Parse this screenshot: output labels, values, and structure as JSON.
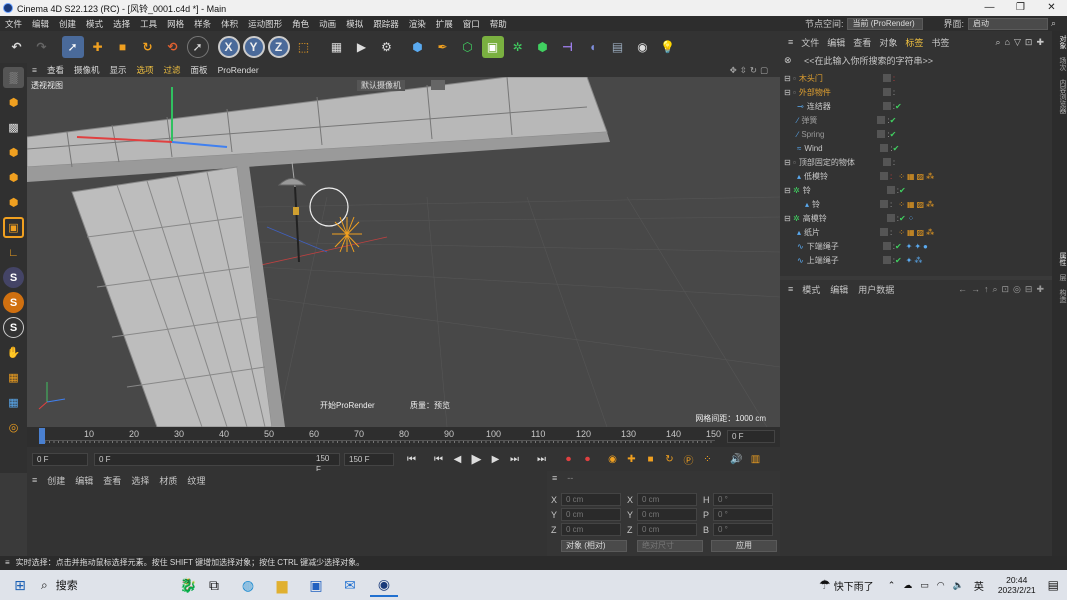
{
  "window": {
    "title": "Cinema 4D S22.123 (RC) - [风铃_0001.c4d *] - Main",
    "min": "—",
    "max": "❐",
    "close": "✕"
  },
  "menubar": {
    "items": [
      "文件",
      "编辑",
      "创建",
      "模式",
      "选择",
      "工具",
      "网格",
      "样条",
      "体积",
      "运动图形",
      "角色",
      "动画",
      "模拟",
      "跟踪器",
      "渲染",
      "扩展",
      "窗口",
      "帮助"
    ],
    "node_space_label": "节点空间:",
    "node_space_value": "当前 (ProRender)",
    "layout_label": "界面:",
    "layout_value": "启动"
  },
  "toolbar": {
    "icons": [
      "undo-icon",
      "redo-icon",
      "live-select-icon",
      "move-icon",
      "scale-icon",
      "rotate-icon",
      "recent-tools-icon",
      "select-icon",
      "x-axis-icon",
      "y-axis-icon",
      "z-axis-icon",
      "coordinate-system-icon",
      "render-view-icon",
      "render-picture-queue-icon",
      "render-settings-icon",
      "cube-icon",
      "pen-icon",
      "subdivision-icon",
      "array-icon",
      "cloner-icon",
      "voronoi-icon",
      "mograph-icon",
      "bend-icon",
      "deformer-icon",
      "floor-icon",
      "camera-icon",
      "light-icon"
    ]
  },
  "viewport": {
    "menu": [
      "查看",
      "摄像机",
      "显示",
      "选项",
      "过滤",
      "面板",
      "ProRender"
    ],
    "label": "透视视图",
    "camera": "默认摄像机",
    "prorender_start": "开始ProRender",
    "quality": "质量：预览",
    "grid_spacing": "网格间距：1000 cm"
  },
  "timeline": {
    "ticks": [
      "0",
      "10",
      "20",
      "30",
      "40",
      "50",
      "60",
      "70",
      "80",
      "90",
      "100",
      "110",
      "120",
      "130",
      "140",
      "150"
    ],
    "current": "0 F"
  },
  "transport": {
    "start": "0 F",
    "field2": "0 F",
    "end_a": "150 F",
    "end_b": "150 F"
  },
  "material": {
    "menu": [
      "创建",
      "编辑",
      "查看",
      "选择",
      "材质",
      "纹理"
    ]
  },
  "coords": {
    "rows": [
      [
        "X",
        "0 cm",
        "X",
        "0 cm",
        "H",
        "0 °"
      ],
      [
        "Y",
        "0 cm",
        "Y",
        "0 cm",
        "P",
        "0 °"
      ],
      [
        "Z",
        "0 cm",
        "Z",
        "0 cm",
        "B",
        "0 °"
      ]
    ],
    "mode": "对象 (相对)",
    "size": "绝对尺寸",
    "apply": "应用",
    "header": "--"
  },
  "objects": {
    "menu": [
      "文件",
      "编辑",
      "查看",
      "对象",
      "标签",
      "书签"
    ],
    "search": "<<在此输入你所搜索的字符串>>",
    "items": [
      {
        "name": "木头门",
        "color": "#e0a030"
      },
      {
        "name": "外部物件",
        "color": "#e0a030"
      },
      {
        "name": "连结器",
        "color": "#c8c8c8"
      },
      {
        "name": "弹簧",
        "color": "#999"
      },
      {
        "name": "Spring",
        "color": "#999"
      },
      {
        "name": "Wind",
        "color": "#c8c8c8"
      },
      {
        "name": "顶部固定的物体",
        "color": "#c8c8c8"
      },
      {
        "name": "低模铃",
        "color": "#c8c8c8"
      },
      {
        "name": "铃",
        "color": "#c8c8c8"
      },
      {
        "name": "铃",
        "color": "#c8c8c8"
      },
      {
        "name": "高模铃",
        "color": "#c8c8c8"
      },
      {
        "name": "纸片",
        "color": "#c8c8c8"
      },
      {
        "name": "下端绳子",
        "color": "#c8c8c8"
      },
      {
        "name": "上端绳子",
        "color": "#c8c8c8"
      }
    ]
  },
  "attributes": {
    "menu": [
      "模式",
      "编辑",
      "用户数据"
    ]
  },
  "right_tabs": [
    "对象",
    "场次",
    "内容浏览器",
    "属性",
    "层",
    "构造"
  ],
  "status": "实时选择：点击并拖动鼠标选择元素。按住 SHIFT 键增加选择对象；按住 CTRL 键减少选择对象。",
  "taskbar": {
    "search": "搜索",
    "weather": "快下雨了",
    "ime": "英",
    "time": "20:44",
    "date": "2023/2/21"
  }
}
